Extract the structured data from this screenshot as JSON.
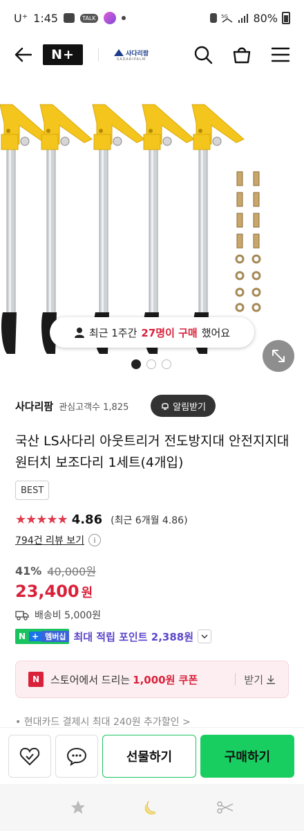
{
  "status": {
    "carrier": "U⁺",
    "time": "1:45",
    "battery": "80%",
    "talk_label": "TALK"
  },
  "header": {
    "brand_badge": "N+",
    "store_logo_name": "사다리팜",
    "store_logo_sub": "SADARIPALM"
  },
  "gallery": {
    "recent_prefix": "최근 1주간",
    "recent_count": "27명이 구매",
    "recent_suffix": "했어요",
    "page_count": 3,
    "active_page": 1
  },
  "seller": {
    "name": "사다리팜",
    "fans": "관심고객수 1,825",
    "alarm_label": "알림받기"
  },
  "product": {
    "title": "국산 LS사다리 아웃트리거 전도방지대 안전지지대 원터치 보조다리 1세트(4개입)",
    "badge": "BEST",
    "stars": "★★★★★",
    "rating": "4.86",
    "rating_recent": "(최근 6개월 4.86)",
    "reviews": "794건 리뷰 보기",
    "discount": "41%",
    "original_price": "40,000원",
    "price": "23,400",
    "currency": "원",
    "shipping": "배송비 5,000원"
  },
  "membership": {
    "badge_n": "N",
    "badge_plus": "+",
    "badge_label": "멤버십",
    "text": "최대 적립 포인트 2,388원"
  },
  "coupon": {
    "badge": "N",
    "prefix": "스토어에서 드리는",
    "amount": "1,000원 쿠폰",
    "action": "받기"
  },
  "card_promo": "• 현대카드 결제시 최대 240원 추가할인 >",
  "buybar": {
    "gift_label": "선물하기",
    "buy_label": "구매하기"
  },
  "colors": {
    "accent_red": "#d9213a",
    "naver_green": "#19ce60",
    "membership_purple": "#5b45c9",
    "yellow_part": "#f4c51c"
  }
}
